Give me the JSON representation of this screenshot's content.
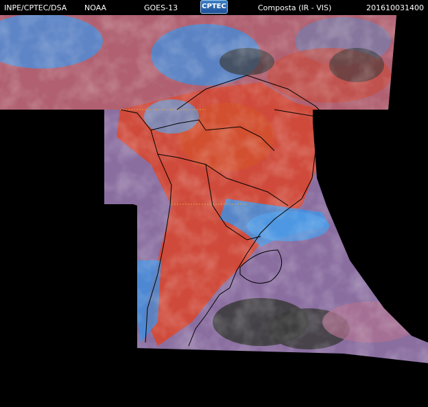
{
  "header": {
    "source": "INPE/CPTEC/DSA",
    "agency": "NOAA",
    "satellite": "GOES-13",
    "logo_text": "CPTEC",
    "product": "Composta (IR - VIS)",
    "timestamp": "201610031400"
  },
  "colors": {
    "background": "#000000",
    "warm_land": "#cf4a3a",
    "cold_cloud": "#3f8fe0",
    "ocean_mix": "#8a6ea0",
    "dark_gaps": "#3c3c3c",
    "borders": "#000000"
  }
}
